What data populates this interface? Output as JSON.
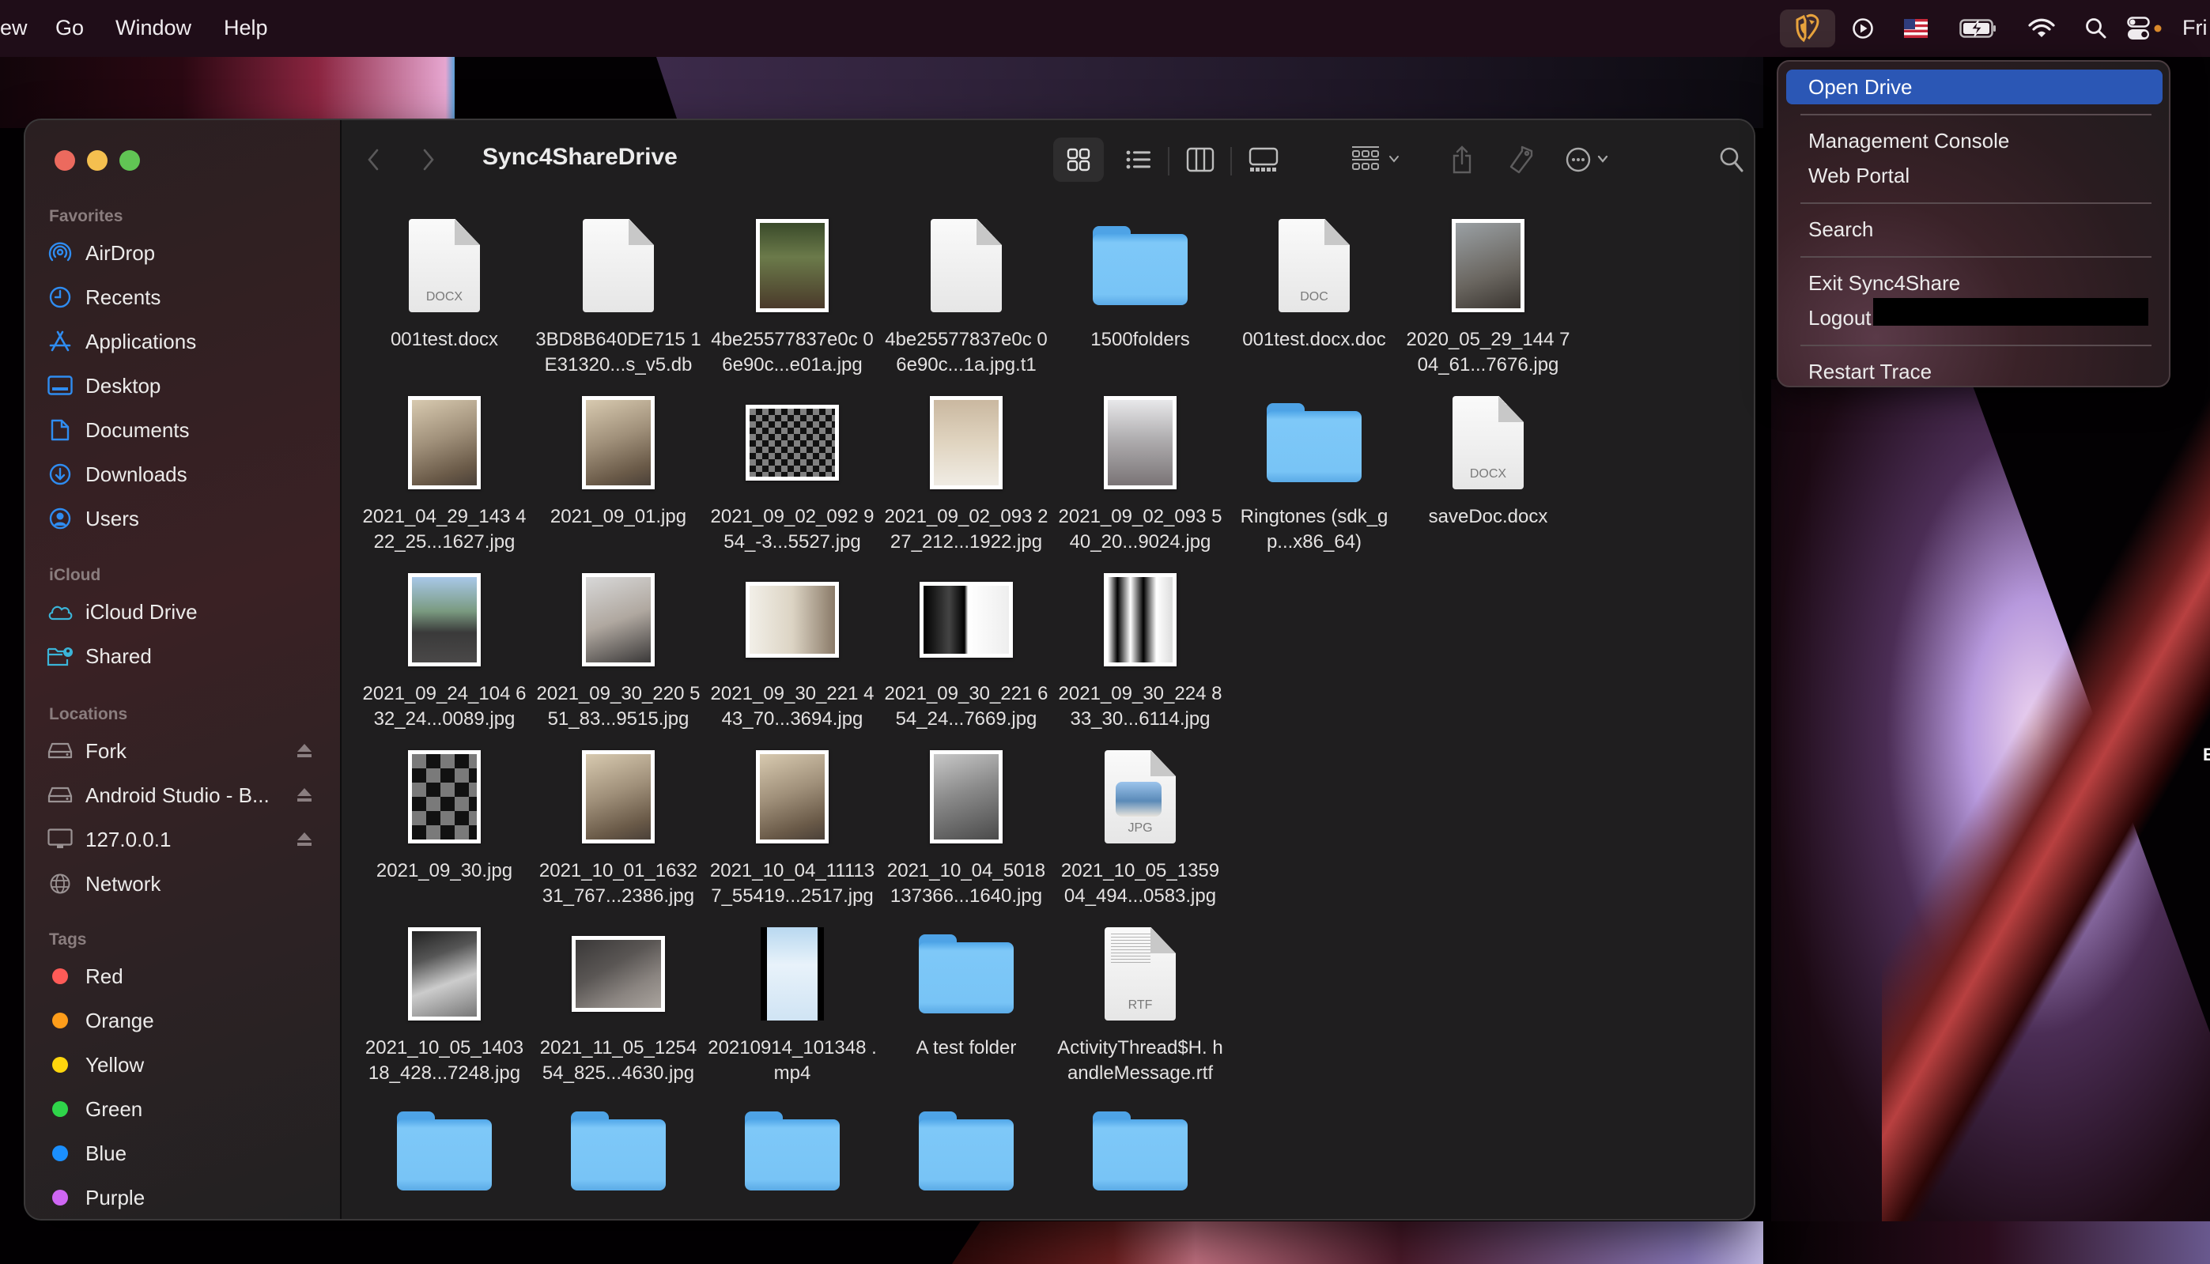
{
  "menubar": {
    "items": [
      "ew",
      "Go",
      "Window",
      "Help"
    ],
    "status_icons": [
      "sync4share-shield-icon",
      "play-circle-icon",
      "us-flag-icon",
      "battery-charging-icon",
      "wifi-icon",
      "spotlight-search-icon",
      "control-center-icon"
    ],
    "clock": "Fri",
    "accent": "#e8a33d"
  },
  "finder": {
    "title": "Sync4ShareDrive",
    "toolbar": {
      "view_modes": [
        "icon-view",
        "list-view",
        "column-view",
        "gallery-view"
      ],
      "selected_view": "icon-view",
      "actions": [
        "group-by",
        "share",
        "tags",
        "more-actions",
        "search"
      ]
    },
    "sidebar": {
      "sections": [
        {
          "heading": "Favorites",
          "items": [
            {
              "label": "AirDrop",
              "icon": "airdrop-icon"
            },
            {
              "label": "Recents",
              "icon": "clock-icon"
            },
            {
              "label": "Applications",
              "icon": "applications-icon"
            },
            {
              "label": "Desktop",
              "icon": "desktop-icon"
            },
            {
              "label": "Documents",
              "icon": "document-icon"
            },
            {
              "label": "Downloads",
              "icon": "download-icon"
            },
            {
              "label": "Users",
              "icon": "user-circle-icon"
            }
          ]
        },
        {
          "heading": "iCloud",
          "items": [
            {
              "label": "iCloud Drive",
              "icon": "cloud-icon"
            },
            {
              "label": "Shared",
              "icon": "shared-folder-icon"
            }
          ]
        },
        {
          "heading": "Locations",
          "items": [
            {
              "label": "Fork",
              "icon": "drive-icon",
              "ejectable": true
            },
            {
              "label": "Android Studio - B...",
              "icon": "drive-icon",
              "ejectable": true
            },
            {
              "label": "127.0.0.1",
              "icon": "display-icon",
              "ejectable": true
            },
            {
              "label": "Network",
              "icon": "globe-icon"
            }
          ]
        },
        {
          "heading": "Tags",
          "items": [
            {
              "label": "Red",
              "color": "#fe5b57"
            },
            {
              "label": "Orange",
              "color": "#fe9d1a"
            },
            {
              "label": "Yellow",
              "color": "#fed60d"
            },
            {
              "label": "Green",
              "color": "#2fd54a"
            },
            {
              "label": "Blue",
              "color": "#1b8ffd"
            },
            {
              "label": "Purple",
              "color": "#cf66f4"
            }
          ]
        }
      ]
    },
    "files": [
      {
        "name": "001test.docx",
        "kind": "doc",
        "ext": "DOCX"
      },
      {
        "name": "3BD8B640DE715 1E31320...s_v5.db",
        "kind": "blank"
      },
      {
        "name": "4be25577837e0c 06e90c...e01a.jpg",
        "kind": "photo",
        "style": "rabbit"
      },
      {
        "name": "4be25577837e0c 06e90c...1a.jpg.t1",
        "kind": "blank"
      },
      {
        "name": "1500folders",
        "kind": "folder"
      },
      {
        "name": "001test.docx.doc",
        "kind": "doc",
        "ext": "DOC"
      },
      {
        "name": "2020_05_29_144 704_61...7676.jpg",
        "kind": "photo",
        "style": "lamp"
      },
      {
        "name": "2021_04_29_143 422_25...1627.jpg",
        "kind": "photo",
        "style": "room"
      },
      {
        "name": "2021_09_01.jpg",
        "kind": "photo",
        "style": "room"
      },
      {
        "name": "2021_09_02_092 954_-3...5527.jpg",
        "kind": "photo",
        "style": "checker",
        "landscape": true
      },
      {
        "name": "2021_09_02_093 227_212...1922.jpg",
        "kind": "photo",
        "style": "ceiling"
      },
      {
        "name": "2021_09_02_093 540_20...9024.jpg",
        "kind": "photo",
        "style": "office"
      },
      {
        "name": "Ringtones (sdk_gp...x86_64)",
        "kind": "folder"
      },
      {
        "name": "saveDoc.docx",
        "kind": "doc",
        "ext": "DOCX"
      },
      {
        "name": "2021_09_24_104 632_24...0089.jpg",
        "kind": "photo",
        "style": "window"
      },
      {
        "name": "2021_09_30_220 551_83...9515.jpg",
        "kind": "photo",
        "style": "desk"
      },
      {
        "name": "2021_09_30_221 443_70...3694.jpg",
        "kind": "photo",
        "style": "corner",
        "landscape": true
      },
      {
        "name": "2021_09_30_221 654_24...7669.jpg",
        "kind": "photo",
        "style": "bw",
        "landscape": true
      },
      {
        "name": "2021_09_30_224 833_30...6114.jpg",
        "kind": "photo",
        "style": "bw2"
      },
      {
        "name": "2021_09_30.jpg",
        "kind": "photo",
        "style": "greychecker"
      },
      {
        "name": "2021_10_01_1632 31_767...2386.jpg",
        "kind": "photo",
        "style": "room"
      },
      {
        "name": "2021_10_04_11113 7_55419...2517.jpg",
        "kind": "photo",
        "style": "room"
      },
      {
        "name": "2021_10_04_5018 137366...1640.jpg",
        "kind": "photo",
        "style": "roomgrey"
      },
      {
        "name": "2021_10_05_1359 04_494...0583.jpg",
        "kind": "doc",
        "ext": "JPG",
        "preview": true
      },
      {
        "name": "2021_10_05_1403 18_428...7248.jpg",
        "kind": "photo",
        "style": "skylight"
      },
      {
        "name": "2021_11_05_1254 54_825...4630.jpg",
        "kind": "photo",
        "style": "laptop",
        "landscape": true
      },
      {
        "name": "20210914_101348 .mp4",
        "kind": "video"
      },
      {
        "name": "A test folder",
        "kind": "folder"
      },
      {
        "name": "ActivityThread$H. handleMessage.rtf",
        "kind": "doc",
        "ext": "RTF",
        "text": true
      },
      {
        "name": "",
        "kind": "folder"
      },
      {
        "name": "",
        "kind": "folder"
      },
      {
        "name": "",
        "kind": "folder"
      },
      {
        "name": "",
        "kind": "folder"
      },
      {
        "name": "",
        "kind": "folder"
      }
    ]
  },
  "status_menu": {
    "items": [
      {
        "label": "Open Drive",
        "highlighted": true
      },
      {
        "separator": true
      },
      {
        "label": "Management Console"
      },
      {
        "label": "Web Portal"
      },
      {
        "separator": true
      },
      {
        "label": "Search"
      },
      {
        "separator": true
      },
      {
        "label": "Exit Sync4Share"
      },
      {
        "label": "Logout",
        "redacted_suffix": true
      },
      {
        "separator": true
      },
      {
        "label": "Restart Trace"
      }
    ],
    "highlight_color": "#2b57b5"
  },
  "edge_text": "E"
}
